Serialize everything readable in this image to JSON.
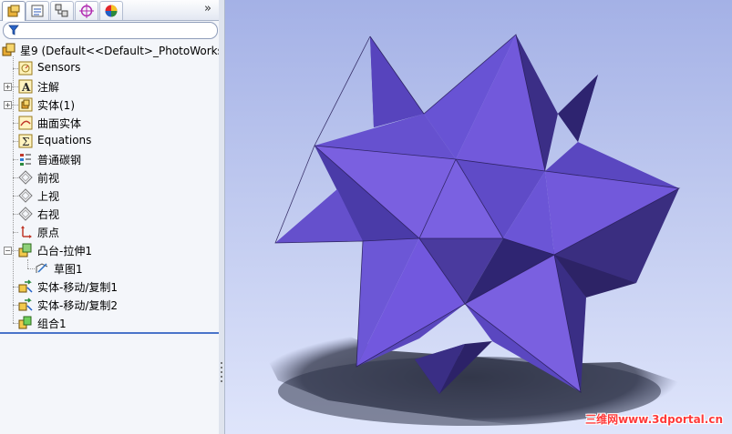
{
  "feature_tree": {
    "tabs": [
      {
        "icon": "feature-manager-icon",
        "active": true
      },
      {
        "icon": "property-manager-icon",
        "active": false
      },
      {
        "icon": "configuration-manager-icon",
        "active": false
      },
      {
        "icon": "dimxpert-icon",
        "active": false
      },
      {
        "icon": "display-manager-icon",
        "active": false
      }
    ],
    "overflow_label": "»",
    "root_label": "星9  (Default<<Default>_PhotoWorks",
    "items": [
      {
        "label": "Sensors",
        "icon": "sensors-icon"
      },
      {
        "label": "注解",
        "icon": "annotations-icon",
        "expandable": true
      },
      {
        "label": "实体(1)",
        "icon": "solid-bodies-icon",
        "expandable": true
      },
      {
        "label": "曲面实体",
        "icon": "surface-bodies-icon"
      },
      {
        "label": "Equations",
        "icon": "equations-icon"
      },
      {
        "label": "普通碳钢",
        "icon": "material-icon"
      },
      {
        "label": "前视",
        "icon": "plane-icon"
      },
      {
        "label": "上视",
        "icon": "plane-icon"
      },
      {
        "label": "右视",
        "icon": "plane-icon"
      },
      {
        "label": "原点",
        "icon": "origin-icon"
      },
      {
        "label": "凸台-拉伸1",
        "icon": "extrude-icon",
        "expandable": true,
        "expanded": true
      },
      {
        "label": "草图1",
        "icon": "sketch-icon",
        "child": true
      },
      {
        "label": "实体-移动/复制1",
        "icon": "move-copy-icon"
      },
      {
        "label": "实体-移动/复制2",
        "icon": "move-copy-icon"
      },
      {
        "label": "组合1",
        "icon": "combine-icon"
      }
    ]
  },
  "graphics": {
    "watermark": "三维网www.3dportal.cn",
    "model_color": "#7055d6"
  }
}
